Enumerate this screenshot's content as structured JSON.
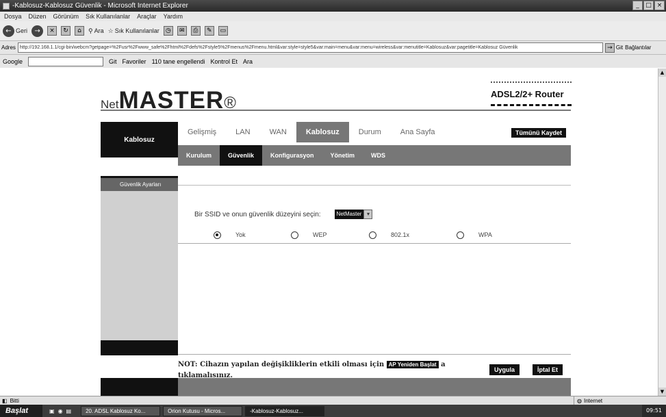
{
  "window": {
    "title": "-Kablosuz-Kablosuz Güvenlik - Microsoft Internet Explorer"
  },
  "menu": [
    "Dosya",
    "Düzen",
    "Görünüm",
    "Sık Kullanılanlar",
    "Araçlar",
    "Yardım"
  ],
  "toolbar": {
    "back_label": "Geri",
    "search_label": "Ara",
    "favorites_label": "Sık Kullanılanlar"
  },
  "address": {
    "label": "Adres",
    "url": "http://192.168.1.1/cgi-bin/webcm?getpage=%2Fusr%2Fwww_safe%2Fhtml%2Fdefs%2Fstyle5%2Fmenus%2Fmenu.html&var:style=style5&var:main=menu&var:menu=wireless&var:menutitle=Kablosuz&var:pagetitle=Kablosuz Güvenlik",
    "go_label": "Git",
    "links_label": "Bağlantılar"
  },
  "googlebar": {
    "label": "Google",
    "items": [
      "Git",
      "Favoriler",
      "110 tane engellendi",
      "Kontrol Et",
      "Ara"
    ]
  },
  "router": {
    "logo_net": "Net",
    "logo_master": "MASTER",
    "logo_mark": "®",
    "model": "ADSL2/2+ Router",
    "sidebar_title": "Kablosuz",
    "sidebar_section": "Güvenlik Ayarları",
    "save_all": "Tümünü Kaydet",
    "main_tabs": [
      "Gelişmiş",
      "LAN",
      "WAN",
      "Kablosuz",
      "Durum",
      "Ana Sayfa"
    ],
    "sub_tabs": [
      "Kurulum",
      "Güvenlik",
      "Konfigurasyon",
      "Yönetim",
      "WDS"
    ],
    "ssid_prompt": "Bir SSID ve onun güvenlik düzeyini seçin:",
    "ssid_value": "NetMaster",
    "security_options": [
      {
        "label": "Yok",
        "selected": true
      },
      {
        "label": "WEP",
        "selected": false
      },
      {
        "label": "802.1x",
        "selected": false
      },
      {
        "label": "WPA",
        "selected": false
      }
    ],
    "note_prefix": "NOT: Cihazın yapılan değişikliklerin etkili olması için",
    "note_button": "AP Yeniden Başlat",
    "note_suffix": "a tıklamalısınız.",
    "apply_label": "Uygula",
    "cancel_label": "İptal Et"
  },
  "status": {
    "text": "Bitti",
    "zone": "Internet"
  },
  "taskbar": {
    "start": "Başlat",
    "tasks": [
      "20. ADSL Kablosuz Ko...",
      "Orion Kutusu - Micros...",
      "-Kablosuz-Kablosuz..."
    ],
    "clock": "09:51"
  }
}
